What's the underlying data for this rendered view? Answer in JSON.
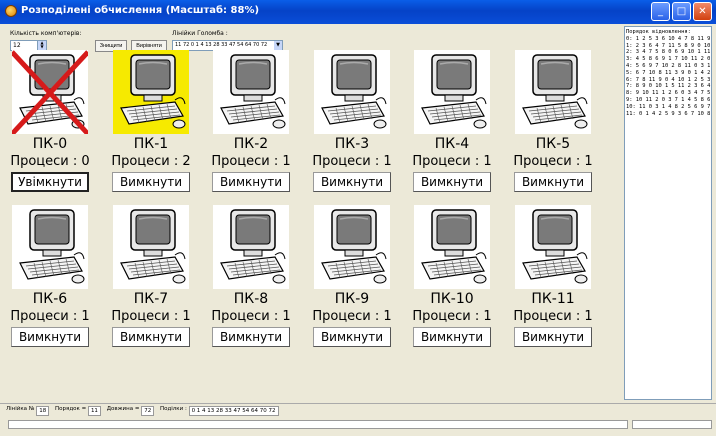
{
  "window": {
    "title": "Розподілені обчислення (Масштаб: 88%)"
  },
  "controls": {
    "count_label": "Кількість комп'ютерів:",
    "count_value": "12",
    "destroy_button": "Знищити",
    "align_button": "Вирівняти",
    "lines_label": "Лінійки Голомба :",
    "lines_selected": "11 72 0 1 4 13 28 33 47 54 64 70 72"
  },
  "computers": [
    {
      "name": "ПК-0",
      "processes": "Процеси : 0",
      "button": "Увімкнути",
      "state": "off"
    },
    {
      "name": "ПК-1",
      "processes": "Процеси : 2",
      "button": "Вимкнути",
      "state": "active"
    },
    {
      "name": "ПК-2",
      "processes": "Процеси : 1",
      "button": "Вимкнути",
      "state": "normal"
    },
    {
      "name": "ПК-3",
      "processes": "Процеси : 1",
      "button": "Вимкнути",
      "state": "normal"
    },
    {
      "name": "ПК-4",
      "processes": "Процеси : 1",
      "button": "Вимкнути",
      "state": "normal"
    },
    {
      "name": "ПК-5",
      "processes": "Процеси : 1",
      "button": "Вимкнути",
      "state": "normal"
    },
    {
      "name": "ПК-6",
      "processes": "Процеси : 1",
      "button": "Вимкнути",
      "state": "normal"
    },
    {
      "name": "ПК-7",
      "processes": "Процеси : 1",
      "button": "Вимкнути",
      "state": "normal"
    },
    {
      "name": "ПК-8",
      "processes": "Процеси : 1",
      "button": "Вимкнути",
      "state": "normal"
    },
    {
      "name": "ПК-9",
      "processes": "Процеси : 1",
      "button": "Вимкнути",
      "state": "normal"
    },
    {
      "name": "ПК-10",
      "processes": "Процеси : 1",
      "button": "Вимкнути",
      "state": "normal"
    },
    {
      "name": "ПК-11",
      "processes": "Процеси : 1",
      "button": "Вимкнути",
      "state": "normal"
    }
  ],
  "recovery": {
    "title": "Порядок відновлення:",
    "lines": [
      "0: 1 2 5 3 6 10 4 7 8 11 9",
      "1: 2 3 6 4 7 11 5 8 9 0 10",
      "2: 3 4 7 5 8 0 6 9 10 1 11",
      "3: 4 5 8 6 9 1 7 10 11 2 0",
      "4: 5 6 9 7 10 2 8 11 0 3 1",
      "5: 6 7 10 8 11 3 9 0 1 4 2",
      "6: 7 8 11 9 0 4 10 1 2 5 3",
      "7: 8 9 0 10 1 5 11 2 3 6 4",
      "8: 9 10 11 1 2 6 0 3 4 7 5",
      "9: 10 11 2 0 3 7 1 4 5 8 6",
      "10: 11 0 3 1 4 8 2 5 6 9 7",
      "11: 0 1 4 2 5 9 3 6 7 10 8"
    ]
  },
  "status": {
    "line_label": "Лінійка №",
    "line_value": "18",
    "order_label": "Порядок =",
    "order_value": "11",
    "length_label": "Довжина =",
    "length_value": "72",
    "divisions_label": "Поділки :",
    "divisions_value": "0 1 4 13 28 33 47 54 64 70 72"
  }
}
